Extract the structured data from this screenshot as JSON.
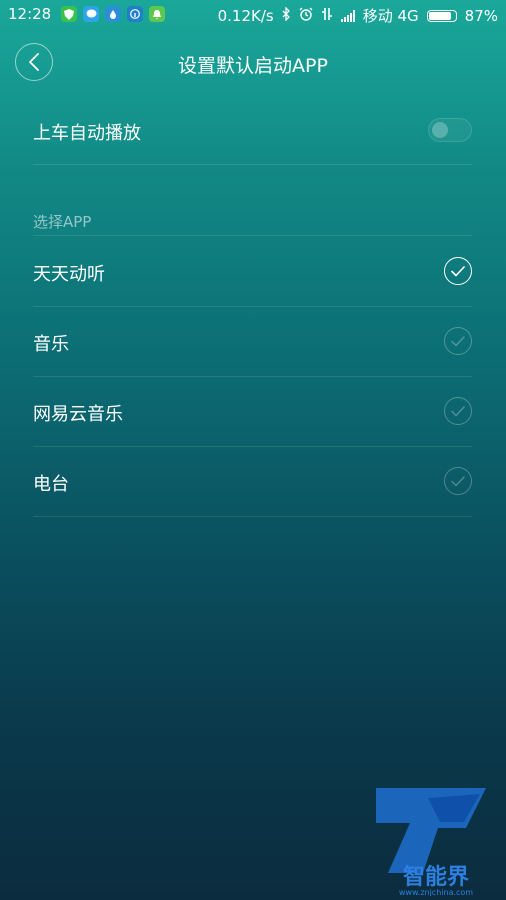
{
  "status_bar": {
    "time": "12:28",
    "speed": "0.12K/s",
    "carrier": "移动 4G",
    "battery": "87%",
    "battery_level": 0.87,
    "icons": [
      "shield-icon",
      "chat-icon",
      "drop-icon",
      "info-icon",
      "notification-icon",
      "bluetooth-icon",
      "alarm-icon",
      "vibrate-icon",
      "signal-icon"
    ]
  },
  "header": {
    "title": "设置默认启动APP"
  },
  "autoplay": {
    "label": "上车自动播放",
    "enabled": false
  },
  "section": {
    "label": "选择APP"
  },
  "apps": [
    {
      "label": "天天动听",
      "selected": true
    },
    {
      "label": "音乐",
      "selected": false
    },
    {
      "label": "网易云音乐",
      "selected": false
    },
    {
      "label": "电台",
      "selected": false
    }
  ],
  "watermark": {
    "text": "智能界",
    "url": "www.znjchina.com"
  },
  "colors": {
    "gradient_top": "#1aa89a",
    "gradient_bottom": "#0b2c3e",
    "accent": "#ffffff"
  }
}
